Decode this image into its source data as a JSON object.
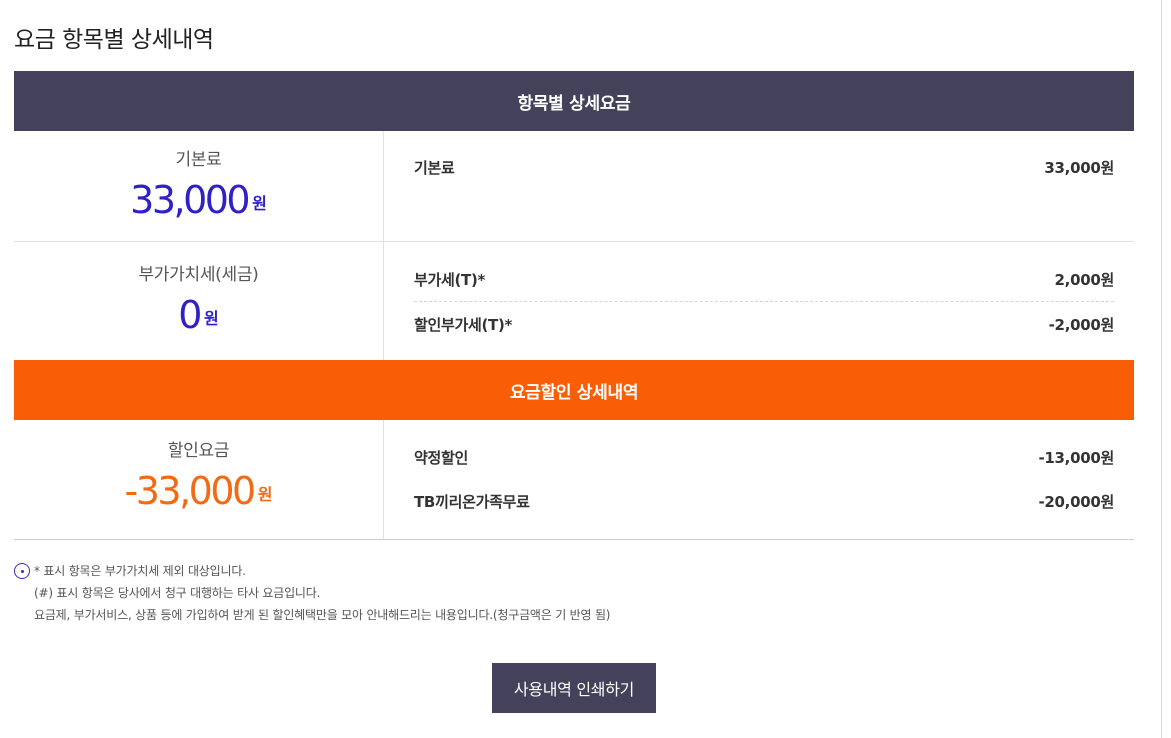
{
  "page_title": "요금 항목별 상세내역",
  "sections": {
    "itemized_title": "항목별 상세요금",
    "discount_title": "요금할인 상세내역"
  },
  "basic_fee": {
    "summary_label": "기본료",
    "summary_amount": "33,000",
    "unit": "원",
    "items": [
      {
        "label": "기본료",
        "value": "33,000원"
      }
    ]
  },
  "vat": {
    "summary_label": "부가가치세(세금)",
    "summary_amount": "0",
    "unit": "원",
    "items": [
      {
        "label": "부가세(T)*",
        "value": "2,000원"
      },
      {
        "label": "할인부가세(T)*",
        "value": "-2,000원"
      }
    ]
  },
  "discount": {
    "summary_label": "할인요금",
    "summary_amount": "-33,000",
    "unit": "원",
    "items": [
      {
        "label": "약정할인",
        "value": "-13,000원"
      },
      {
        "label": "TB끼리온가족무료",
        "value": "-20,000원"
      }
    ]
  },
  "notes": [
    "* 표시 항목은 부가가치세 제외 대상입니다.",
    "(#) 표시 항목은 당사에서 청구 대행하는 타사 요금입니다.",
    "요금제, 부가서비스, 상품 등에 가입하여 받게 된 할인혜택만을 모아 안내해드리는 내용입니다.(청구금액은 기 반영 됨)"
  ],
  "print_button_label": "사용내역 인쇄하기",
  "colors": {
    "header_dark": "#43425a",
    "header_orange": "#f95e07",
    "amount_blue": "#2f21c4",
    "amount_orange": "#f26a12"
  }
}
